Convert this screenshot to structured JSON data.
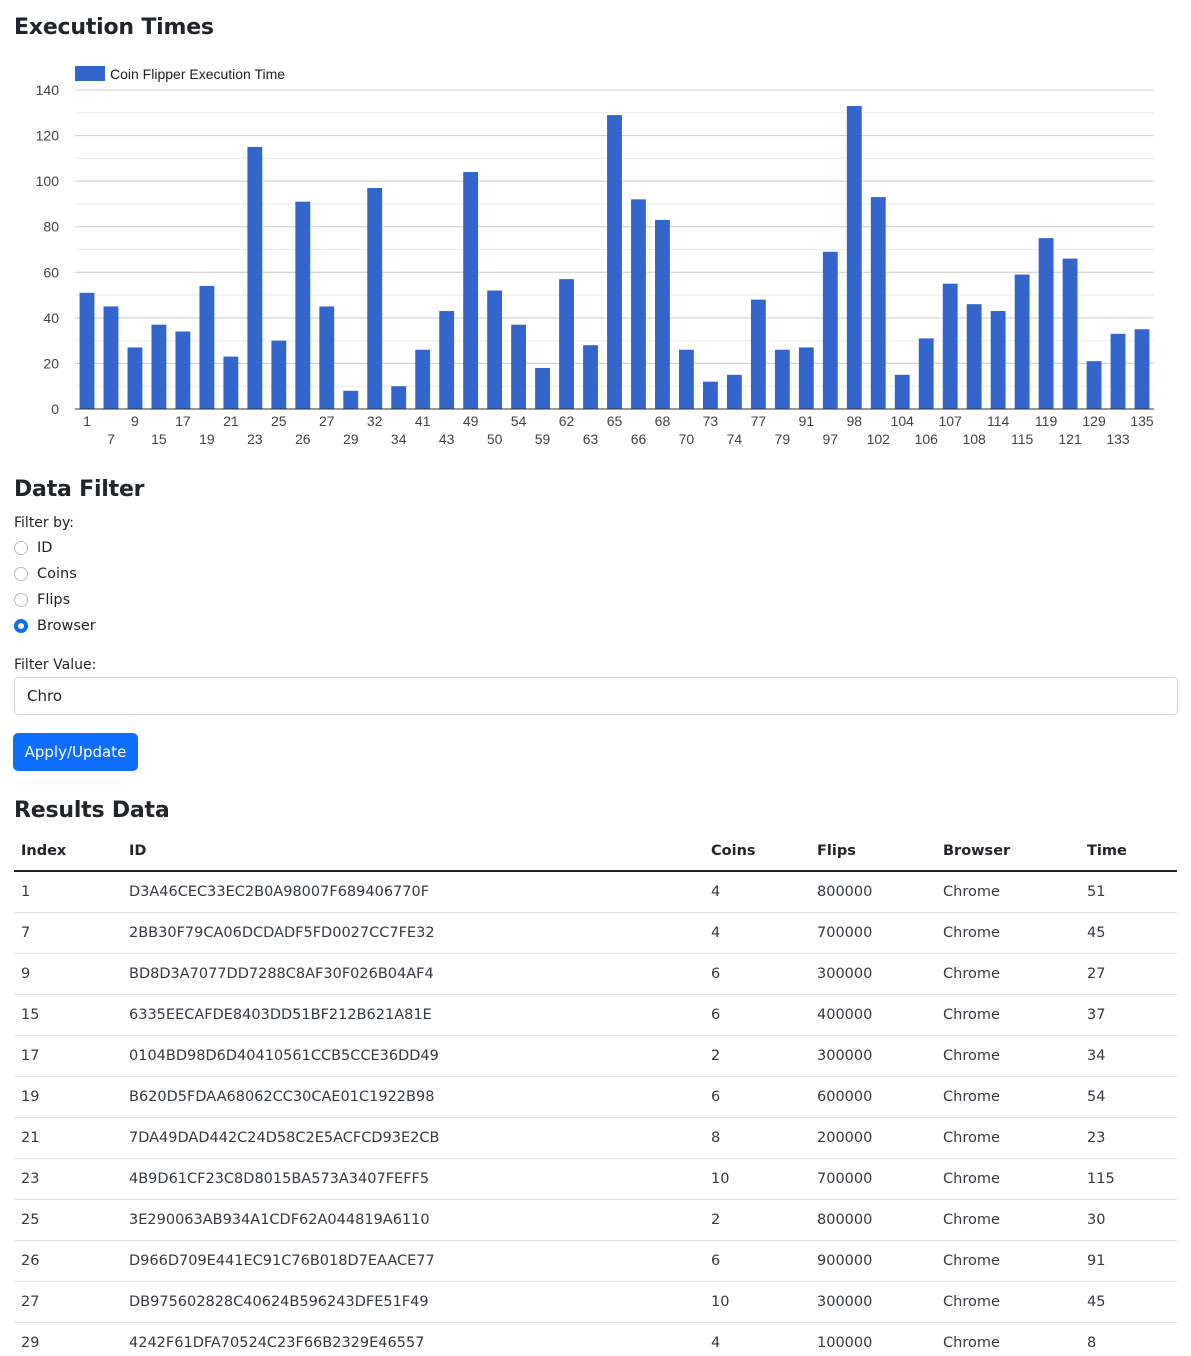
{
  "chart_section": {
    "heading": "Execution Times"
  },
  "chart_data": {
    "type": "bar",
    "title": "",
    "xlabel": "",
    "ylabel": "",
    "ylim": [
      0,
      140
    ],
    "yticks": [
      0,
      20,
      40,
      60,
      80,
      100,
      120,
      140
    ],
    "grid": true,
    "legend_position": "top-left",
    "series": [
      {
        "name": "Coin Flipper Execution Time",
        "color": "#3366cc",
        "values": [
          51,
          45,
          27,
          37,
          34,
          54,
          23,
          115,
          30,
          91,
          45,
          8,
          97,
          10,
          26,
          43,
          104,
          52,
          37,
          18,
          57,
          28,
          129,
          92,
          83,
          26,
          12,
          15,
          48,
          26,
          27,
          69,
          133,
          93,
          15,
          31,
          55,
          46,
          43,
          59,
          75,
          66,
          21,
          33,
          35
        ]
      }
    ],
    "categories": [
      "1",
      "7",
      "9",
      "15",
      "17",
      "19",
      "21",
      "23",
      "25",
      "26",
      "27",
      "29",
      "32",
      "34",
      "41",
      "43",
      "49",
      "50",
      "54",
      "59",
      "62",
      "63",
      "65",
      "66",
      "68",
      "70",
      "73",
      "74",
      "77",
      "79",
      "91",
      "97",
      "98",
      "102",
      "104",
      "106",
      "107",
      "108",
      "114",
      "115",
      "119",
      "121",
      "129",
      "133",
      "135"
    ]
  },
  "filter": {
    "heading": "Data Filter",
    "filter_by_label": "Filter by:",
    "options": [
      {
        "label": "ID",
        "checked": false
      },
      {
        "label": "Coins",
        "checked": false
      },
      {
        "label": "Flips",
        "checked": false
      },
      {
        "label": "Browser",
        "checked": true
      }
    ],
    "value_label": "Filter Value:",
    "value": "Chro",
    "apply_label": "Apply/Update"
  },
  "results": {
    "heading": "Results Data",
    "columns": [
      "Index",
      "ID",
      "Coins",
      "Flips",
      "Browser",
      "Time"
    ],
    "rows": [
      [
        "1",
        "D3A46CEC33EC2B0A98007F689406770F",
        "4",
        "800000",
        "Chrome",
        "51"
      ],
      [
        "7",
        "2BB30F79CA06DCDADF5FD0027CC7FE32",
        "4",
        "700000",
        "Chrome",
        "45"
      ],
      [
        "9",
        "BD8D3A7077DD7288C8AF30F026B04AF4",
        "6",
        "300000",
        "Chrome",
        "27"
      ],
      [
        "15",
        "6335EECAFDE8403DD51BF212B621A81E",
        "6",
        "400000",
        "Chrome",
        "37"
      ],
      [
        "17",
        "0104BD98D6D40410561CCB5CCE36DD49",
        "2",
        "300000",
        "Chrome",
        "34"
      ],
      [
        "19",
        "B620D5FDAA68062CC30CAE01C1922B98",
        "6",
        "600000",
        "Chrome",
        "54"
      ],
      [
        "21",
        "7DA49DAD442C24D58C2E5ACFCD93E2CB",
        "8",
        "200000",
        "Chrome",
        "23"
      ],
      [
        "23",
        "4B9D61CF23C8D8015BA573A3407FEFF5",
        "10",
        "700000",
        "Chrome",
        "115"
      ],
      [
        "25",
        "3E290063AB934A1CDF62A044819A6110",
        "2",
        "800000",
        "Chrome",
        "30"
      ],
      [
        "26",
        "D966D709E441EC91C76B018D7EAACE77",
        "6",
        "900000",
        "Chrome",
        "91"
      ],
      [
        "27",
        "DB975602828C40624B596243DFE51F49",
        "10",
        "300000",
        "Chrome",
        "45"
      ],
      [
        "29",
        "4242F61DFA70524C23F66B2329E46557",
        "4",
        "100000",
        "Chrome",
        "8"
      ]
    ]
  }
}
